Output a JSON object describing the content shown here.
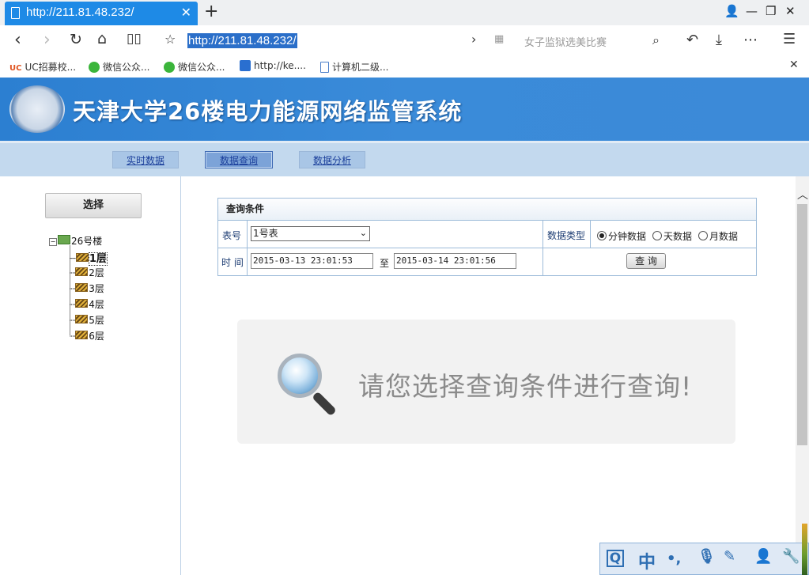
{
  "browser": {
    "tab_title": "http://211.81.48.232/",
    "url": "http://211.81.48.232/",
    "search_placeholder": "女子监狱选美比赛",
    "bookmarks": [
      "UC招募校...",
      "微信公众...",
      "微信公众...",
      "http://ke....",
      "计算机二级..."
    ]
  },
  "page": {
    "title": "天津大学26楼电力能源网络监管系统",
    "nav": [
      "实时数据",
      "数据查询",
      "数据分析"
    ],
    "select_label": "选择",
    "tree": {
      "root": "26号楼",
      "floors": [
        "1层",
        "2层",
        "3层",
        "4层",
        "5层",
        "6层"
      ],
      "selected": "1层"
    },
    "query": {
      "header": "查询条件",
      "meter_label": "表号",
      "meter_value": "1号表",
      "type_label": "数据类型",
      "types": [
        "分钟数据",
        "天数据",
        "月数据"
      ],
      "selected_type": "分钟数据",
      "time_label": "时 间",
      "start": "2015-03-13 23:01:53",
      "to": "至",
      "end": "2015-03-14 23:01:56",
      "submit": "查 询"
    },
    "prompt": "请您选择查询条件进行查询!",
    "ime": [
      "中",
      "•,"
    ]
  }
}
